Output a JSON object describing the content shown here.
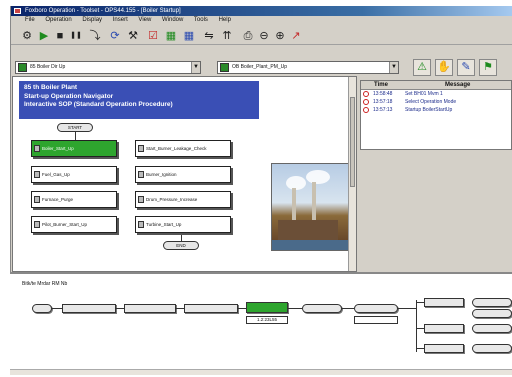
{
  "window": {
    "title": "Foxboro Operation - Toolset - OPS44.155 - [Boiler Startup]"
  },
  "menu": {
    "items": [
      "File",
      "Operation",
      "Display",
      "Insert",
      "View",
      "Window",
      "Tools",
      "Help"
    ]
  },
  "toolbar": {
    "icons": [
      "new-procedure-icon",
      "run-icon",
      "stop-icon",
      "pause-icon",
      "step-icon",
      "loop-icon",
      "connect-icon",
      "node-icon",
      "branch-icon",
      "grid-icon",
      "tag-icon",
      "export-icon",
      "print-icon",
      "zoom-out-icon",
      "zoom-in-icon",
      "trend-icon"
    ],
    "glyphs": [
      "⚙",
      "▶",
      "■",
      "❚❚",
      "⤵",
      "⟳",
      "⚒",
      "☑",
      "▦",
      "▦",
      "⇋",
      "⇈",
      "⎙",
      "⊖",
      "⊕",
      "↗"
    ]
  },
  "selectors": {
    "plant_value": "85 Boiler Dir Up",
    "procedure_value": "OB Boiler_Plant_PM_Up",
    "action_glyphs": [
      "⚠",
      "✋",
      "✎",
      "⚑"
    ]
  },
  "diagram": {
    "header_lines": [
      "85 th Boiler Plant",
      "Start-up Operation Navigator",
      "Interactive SOP (Standard Operation Procedure)"
    ],
    "start_label": "START",
    "end_label": "END",
    "steps_left": [
      {
        "label": "Boiler_Start_Up",
        "active": true
      },
      {
        "label": "Fuel_Gas_Up",
        "active": false
      },
      {
        "label": "Furnace_Purge",
        "active": false
      },
      {
        "label": "Pilot_Burner_Start_Up",
        "active": false
      }
    ],
    "steps_right": [
      {
        "label": "Start_Burner_Leakage_Check",
        "active": false
      },
      {
        "label": "Burner_Ignition",
        "active": false
      },
      {
        "label": "Drum_Pressure_Increase",
        "active": false
      },
      {
        "label": "Turbine_Start_Up",
        "active": false
      }
    ]
  },
  "events": {
    "columns": [
      "Time",
      "Message"
    ],
    "rows": [
      {
        "time": "13:58:48",
        "message": "Set BH01 Mvm 1"
      },
      {
        "time": "13:57:18",
        "message": "Select Operation Mode"
      },
      {
        "time": "13:57:13",
        "message": "Startup BoilerStartUp"
      }
    ]
  },
  "flow": {
    "tab_label": "Bitk/te Mrdar RM Nb",
    "nodes": [
      "",
      "",
      "",
      "",
      "",
      "",
      "",
      "",
      "",
      "",
      "",
      ""
    ],
    "value_boxes": [
      "1.2:23L55",
      "",
      ""
    ]
  }
}
